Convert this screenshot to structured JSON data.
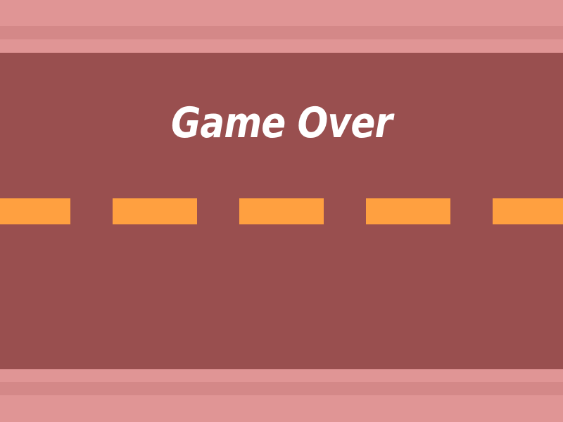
{
  "game": {
    "title": "Game Over"
  },
  "colors": {
    "road": "#994f4f",
    "sidewalk": "#e09595",
    "curb_stripe": "#d48888",
    "lane_marking": "#ffa040",
    "title_text": "#ffffff"
  }
}
